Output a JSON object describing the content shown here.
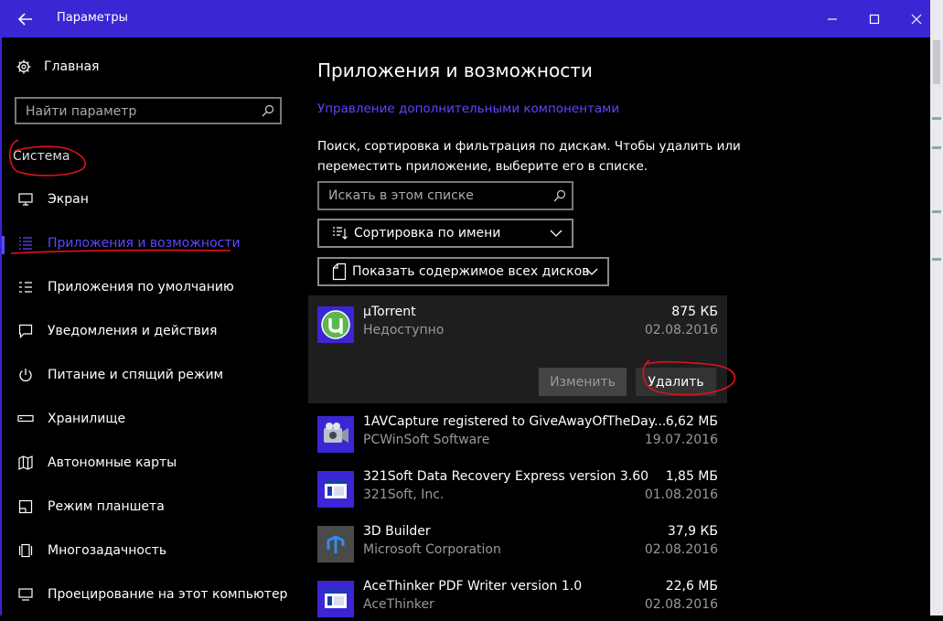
{
  "window": {
    "title": "Параметры",
    "accent_color": "#3B26D4",
    "link_color": "#5A48FF"
  },
  "sidebar": {
    "home_label": "Главная",
    "search_placeholder": "Найти параметр",
    "section_label": "Система",
    "items": [
      {
        "label": "Экран",
        "icon": "monitor-icon"
      },
      {
        "label": "Приложения и возможности",
        "icon": "apps-list-icon",
        "active": true
      },
      {
        "label": "Приложения по умолчанию",
        "icon": "default-apps-icon"
      },
      {
        "label": "Уведомления и действия",
        "icon": "notification-icon"
      },
      {
        "label": "Питание и спящий режим",
        "icon": "power-icon"
      },
      {
        "label": "Хранилище",
        "icon": "storage-icon"
      },
      {
        "label": "Автономные карты",
        "icon": "map-icon"
      },
      {
        "label": "Режим планшета",
        "icon": "tablet-icon"
      },
      {
        "label": "Многозадачность",
        "icon": "multitask-icon"
      },
      {
        "label": "Проецирование на этот компьютер",
        "icon": "projection-icon"
      }
    ]
  },
  "main": {
    "title": "Приложения и возможности",
    "manage_link": "Управление дополнительными компонентами",
    "description": "Поиск, сортировка и фильтрация по дискам. Чтобы удалить или переместить приложение, выберите его в списке.",
    "list_search_placeholder": "Искать в этом списке",
    "sort_label": "Сортировка по имени",
    "drive_label": "Показать содержимое всех дисков",
    "modify_button": "Изменить",
    "remove_button": "Удалить",
    "apps": [
      {
        "name": "µTorrent",
        "publisher": "Недоступно",
        "size": "875 КБ",
        "date": "02.08.2016",
        "icon": "utorrent-icon",
        "selected": true
      },
      {
        "name": "1AVCapture registered to GiveAwayOfTheDay...",
        "publisher": "PCWinSoft Software",
        "size": "6,62 МБ",
        "date": "19.07.2016",
        "icon": "camcorder-icon"
      },
      {
        "name": "321Soft Data Recovery Express version 3.60",
        "publisher": "321Soft, Inc.",
        "size": "1,85 МБ",
        "date": "01.08.2016",
        "icon": "installer-icon"
      },
      {
        "name": "3D Builder",
        "publisher": "Microsoft Corporation",
        "size": "37,9 КБ",
        "date": "02.08.2016",
        "icon": "3d-builder-icon"
      },
      {
        "name": "AceThinker PDF Writer version 1.0",
        "publisher": "AceThinker",
        "size": "22,6 МБ",
        "date": "02.08.2016",
        "icon": "installer-icon"
      }
    ]
  }
}
